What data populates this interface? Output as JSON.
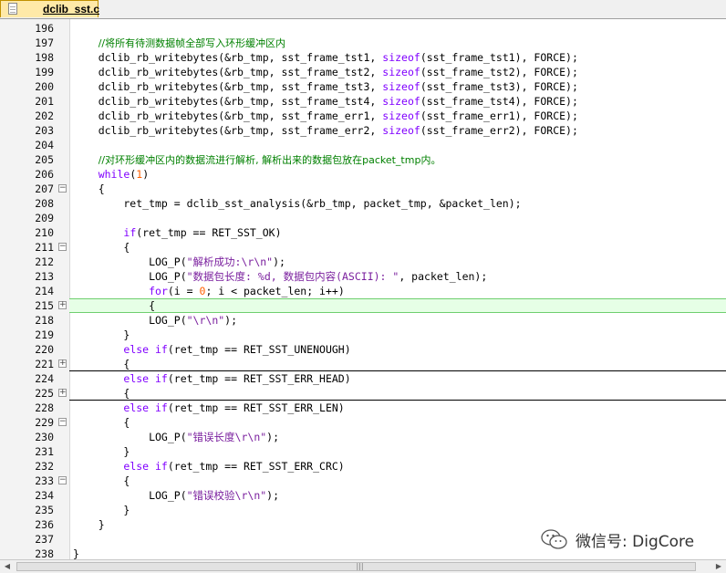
{
  "tab": {
    "filename": "dclib_sst.c"
  },
  "editor": {
    "lines": [
      {
        "num": "196",
        "fold": "",
        "tokens": []
      },
      {
        "num": "197",
        "fold": "",
        "tokens": [
          {
            "t": "    "
          },
          {
            "t": "//将所有待测数据帧全部写入环形缓冲区内",
            "c": "cm"
          }
        ]
      },
      {
        "num": "198",
        "fold": "",
        "tokens": [
          {
            "t": "    dclib_rb_writebytes(&rb_tmp, sst_frame_tst1, "
          },
          {
            "t": "sizeof",
            "c": "kw"
          },
          {
            "t": "(sst_frame_tst1), FORCE);"
          }
        ]
      },
      {
        "num": "199",
        "fold": "",
        "tokens": [
          {
            "t": "    dclib_rb_writebytes(&rb_tmp, sst_frame_tst2, "
          },
          {
            "t": "sizeof",
            "c": "kw"
          },
          {
            "t": "(sst_frame_tst2), FORCE);"
          }
        ]
      },
      {
        "num": "200",
        "fold": "",
        "tokens": [
          {
            "t": "    dclib_rb_writebytes(&rb_tmp, sst_frame_tst3, "
          },
          {
            "t": "sizeof",
            "c": "kw"
          },
          {
            "t": "(sst_frame_tst3), FORCE);"
          }
        ]
      },
      {
        "num": "201",
        "fold": "",
        "tokens": [
          {
            "t": "    dclib_rb_writebytes(&rb_tmp, sst_frame_tst4, "
          },
          {
            "t": "sizeof",
            "c": "kw"
          },
          {
            "t": "(sst_frame_tst4), FORCE);"
          }
        ]
      },
      {
        "num": "202",
        "fold": "",
        "tokens": [
          {
            "t": "    dclib_rb_writebytes(&rb_tmp, sst_frame_err1, "
          },
          {
            "t": "sizeof",
            "c": "kw"
          },
          {
            "t": "(sst_frame_err1), FORCE);"
          }
        ]
      },
      {
        "num": "203",
        "fold": "",
        "tokens": [
          {
            "t": "    dclib_rb_writebytes(&rb_tmp, sst_frame_err2, "
          },
          {
            "t": "sizeof",
            "c": "kw"
          },
          {
            "t": "(sst_frame_err2), FORCE);"
          }
        ]
      },
      {
        "num": "204",
        "fold": "",
        "tokens": []
      },
      {
        "num": "205",
        "fold": "",
        "tokens": [
          {
            "t": "    "
          },
          {
            "t": "//对环形缓冲区内的数据流进行解析, 解析出来的数据包放在packet_tmp内。",
            "c": "cm"
          }
        ]
      },
      {
        "num": "206",
        "fold": "",
        "tokens": [
          {
            "t": "    "
          },
          {
            "t": "while",
            "c": "kw"
          },
          {
            "t": "("
          },
          {
            "t": "1",
            "c": "nm"
          },
          {
            "t": ")"
          }
        ]
      },
      {
        "num": "207",
        "fold": "minus",
        "tokens": [
          {
            "t": "    {"
          }
        ]
      },
      {
        "num": "208",
        "fold": "",
        "tokens": [
          {
            "t": "        ret_tmp = dclib_sst_analysis(&rb_tmp, packet_tmp, &packet_len);"
          }
        ]
      },
      {
        "num": "209",
        "fold": "",
        "tokens": []
      },
      {
        "num": "210",
        "fold": "",
        "tokens": [
          {
            "t": "        "
          },
          {
            "t": "if",
            "c": "kw"
          },
          {
            "t": "(ret_tmp == RET_SST_OK)"
          }
        ]
      },
      {
        "num": "211",
        "fold": "minus",
        "tokens": [
          {
            "t": "        {"
          }
        ]
      },
      {
        "num": "212",
        "fold": "",
        "tokens": [
          {
            "t": "            LOG_P("
          },
          {
            "t": "\"解析成功:\\r\\n\"",
            "c": "st"
          },
          {
            "t": ");"
          }
        ]
      },
      {
        "num": "213",
        "fold": "",
        "tokens": [
          {
            "t": "            LOG_P("
          },
          {
            "t": "\"数据包长度: %d, 数据包内容(ASCII): \"",
            "c": "st"
          },
          {
            "t": ", packet_len);"
          }
        ]
      },
      {
        "num": "214",
        "fold": "",
        "tokens": [
          {
            "t": "            "
          },
          {
            "t": "for",
            "c": "kw"
          },
          {
            "t": "(i = "
          },
          {
            "t": "0",
            "c": "nm"
          },
          {
            "t": "; i < packet_len; i++)"
          }
        ]
      },
      {
        "num": "215",
        "fold": "plus",
        "hl": true,
        "tokens": [
          {
            "t": "            {"
          }
        ]
      },
      {
        "num": "218",
        "fold": "",
        "tokens": [
          {
            "t": "            LOG_P("
          },
          {
            "t": "\"\\r\\n\"",
            "c": "st"
          },
          {
            "t": ");"
          }
        ]
      },
      {
        "num": "219",
        "fold": "",
        "tokens": [
          {
            "t": "        }"
          }
        ]
      },
      {
        "num": "220",
        "fold": "",
        "tokens": [
          {
            "t": "        "
          },
          {
            "t": "else if",
            "c": "kw"
          },
          {
            "t": "(ret_tmp == RET_SST_UNENOUGH)"
          }
        ]
      },
      {
        "num": "221",
        "fold": "plus",
        "sep": true,
        "tokens": [
          {
            "t": "        {"
          }
        ]
      },
      {
        "num": "224",
        "fold": "",
        "tokens": [
          {
            "t": "        "
          },
          {
            "t": "else if",
            "c": "kw"
          },
          {
            "t": "(ret_tmp == RET_SST_ERR_HEAD)"
          }
        ]
      },
      {
        "num": "225",
        "fold": "plus",
        "sep": true,
        "tokens": [
          {
            "t": "        {"
          }
        ]
      },
      {
        "num": "228",
        "fold": "",
        "tokens": [
          {
            "t": "        "
          },
          {
            "t": "else if",
            "c": "kw"
          },
          {
            "t": "(ret_tmp == RET_SST_ERR_LEN)"
          }
        ]
      },
      {
        "num": "229",
        "fold": "minus",
        "tokens": [
          {
            "t": "        {"
          }
        ]
      },
      {
        "num": "230",
        "fold": "",
        "tokens": [
          {
            "t": "            LOG_P("
          },
          {
            "t": "\"错误长度\\r\\n\"",
            "c": "st"
          },
          {
            "t": ");"
          }
        ]
      },
      {
        "num": "231",
        "fold": "",
        "tokens": [
          {
            "t": "        }"
          }
        ]
      },
      {
        "num": "232",
        "fold": "",
        "tokens": [
          {
            "t": "        "
          },
          {
            "t": "else if",
            "c": "kw"
          },
          {
            "t": "(ret_tmp == RET_SST_ERR_CRC)"
          }
        ]
      },
      {
        "num": "233",
        "fold": "minus",
        "tokens": [
          {
            "t": "        {"
          }
        ]
      },
      {
        "num": "234",
        "fold": "",
        "tokens": [
          {
            "t": "            LOG_P("
          },
          {
            "t": "\"错误校验\\r\\n\"",
            "c": "st"
          },
          {
            "t": ");"
          }
        ]
      },
      {
        "num": "235",
        "fold": "",
        "tokens": [
          {
            "t": "        }"
          }
        ]
      },
      {
        "num": "236",
        "fold": "",
        "tokens": [
          {
            "t": "    }"
          }
        ]
      },
      {
        "num": "237",
        "fold": "",
        "tokens": []
      },
      {
        "num": "238",
        "fold": "",
        "tokens": [
          {
            "t": "}"
          }
        ]
      }
    ]
  },
  "colors": {
    "keyword": "#8000ff",
    "comment": "#008000",
    "string": "#7a1f9e",
    "number": "#ff6000",
    "highlight": "#e6ffe6"
  },
  "icons": {
    "file": "document-icon",
    "fold_open": "minus-box-icon",
    "fold_closed": "plus-box-icon",
    "watermark": "wechat-icon"
  },
  "watermark": {
    "text": "微信号: DigCore"
  }
}
